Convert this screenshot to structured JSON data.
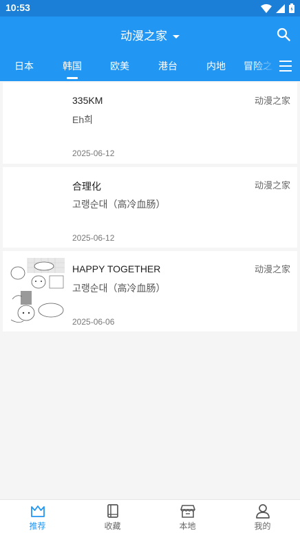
{
  "status_bar": {
    "time": "10:53"
  },
  "header": {
    "title": "动漫之家"
  },
  "tabs": [
    {
      "label": "日本",
      "selected": false
    },
    {
      "label": "韩国",
      "selected": true
    },
    {
      "label": "欧美",
      "selected": false
    },
    {
      "label": "港台",
      "selected": false
    },
    {
      "label": "内地",
      "selected": false
    },
    {
      "label": "冒险之",
      "selected": false
    }
  ],
  "items": [
    {
      "title": "335KM",
      "author": "Eh희",
      "date": "2025-06-12",
      "source": "动漫之家"
    },
    {
      "title": "合理化",
      "author": "고랭순대（高冷血肠）",
      "date": "2025-06-12",
      "source": "动漫之家"
    },
    {
      "title": "HAPPY TOGETHER",
      "author": "고랭순대（高冷血肠）",
      "date": "2025-06-06",
      "source": "动漫之家"
    }
  ],
  "bottom_nav": [
    {
      "label": "推荐",
      "icon": "crown-icon",
      "active": true
    },
    {
      "label": "收藏",
      "icon": "book-icon",
      "active": false
    },
    {
      "label": "本地",
      "icon": "store-icon",
      "active": false
    },
    {
      "label": "我的",
      "icon": "person-icon",
      "active": false
    }
  ],
  "colors": {
    "primary": "#2196f3",
    "status_bar": "#1b7fd8"
  }
}
